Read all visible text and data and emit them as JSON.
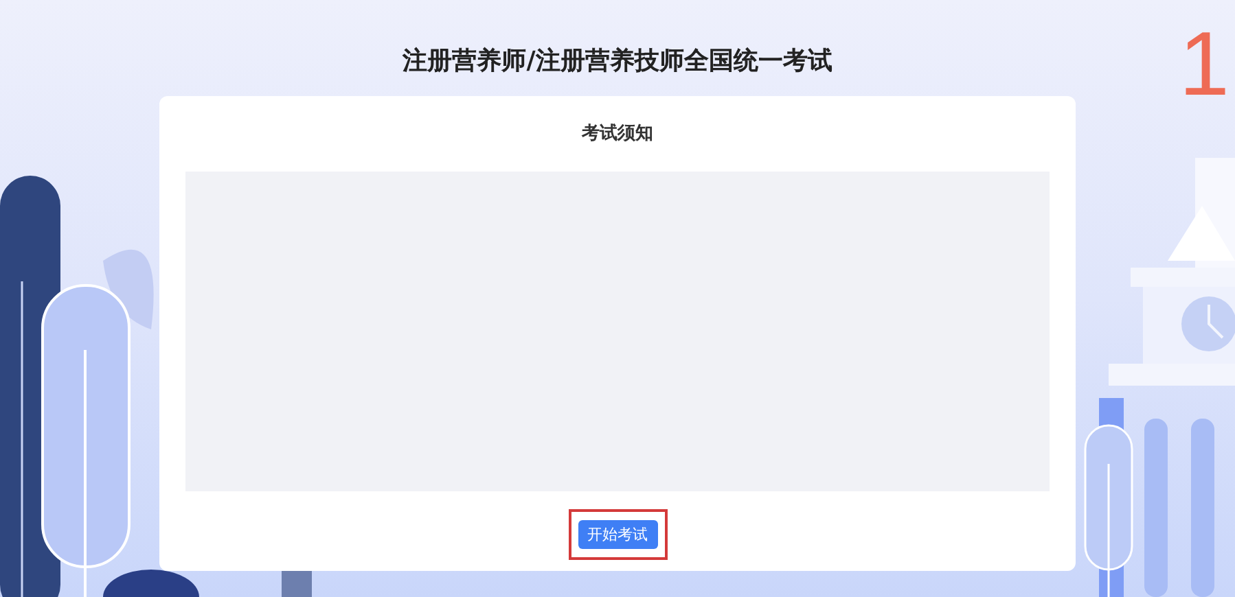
{
  "page_title": "注册营养师/注册营养技师全国统一考试",
  "step_number": "1",
  "notice_card": {
    "title": "考试须知",
    "start_button": {
      "label": "开始考试",
      "highlighted": true
    }
  }
}
